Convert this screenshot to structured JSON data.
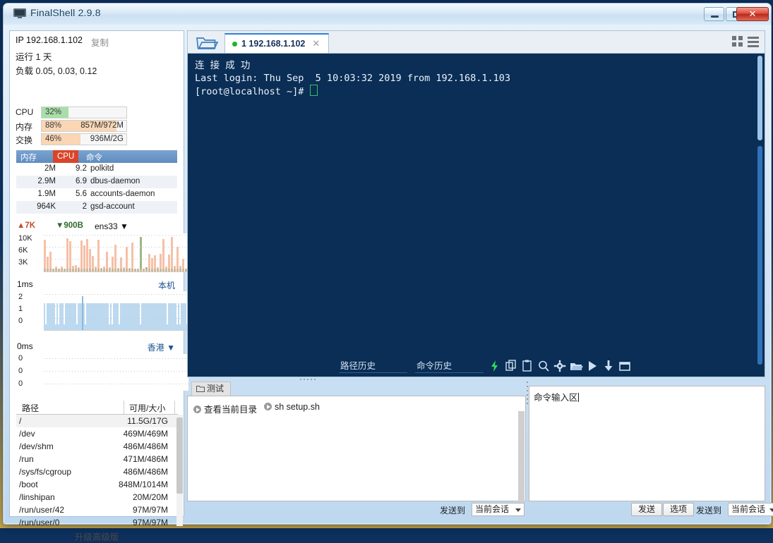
{
  "window": {
    "title": "FinalShell 2.9.8",
    "app_icon": "monitor-icon",
    "minimize": "–",
    "maximize": "□",
    "close": "✕"
  },
  "sidebar": {
    "ip_label": "IP 192.168.1.102",
    "copy_label": "复制",
    "uptime": "运行 1 天",
    "load": "负载 0.05, 0.03, 0.12",
    "meters": [
      {
        "name": "CPU",
        "percent": "32%",
        "value": "",
        "fill": 32,
        "color": "#a8dfa8"
      },
      {
        "name": "内存",
        "percent": "88%",
        "value": "857M/972M",
        "fill": 88,
        "color": "#fad6b4"
      },
      {
        "name": "交换",
        "percent": "46%",
        "value": "936M/2G",
        "fill": 46,
        "color": "#fad6b4"
      }
    ],
    "process_table": {
      "headers": [
        "内存",
        "CPU",
        "命令"
      ],
      "rows": [
        {
          "mem": "2M",
          "cpu": "9.2",
          "cmd": "polkitd"
        },
        {
          "mem": "2.9M",
          "cpu": "6.9",
          "cmd": "dbus-daemon"
        },
        {
          "mem": "1.9M",
          "cpu": "5.6",
          "cmd": "accounts-daemon"
        },
        {
          "mem": "964K",
          "cpu": "2",
          "cmd": "gsd-account"
        }
      ]
    },
    "network": {
      "upload": "7K",
      "download": "900B",
      "interface": "ens33",
      "y_ticks": [
        "10K",
        "6K",
        "3K"
      ]
    },
    "ping_local": {
      "unit": "1ms",
      "location": "本机",
      "y_ticks": [
        "2",
        "1",
        "0"
      ]
    },
    "ping_remote": {
      "unit": "0ms",
      "location": "香港",
      "y_ticks": [
        "0",
        "0",
        "0"
      ]
    },
    "disk_table": {
      "headers": [
        "路径",
        "可用/大小"
      ],
      "rows": [
        {
          "path": "/",
          "size": "11.5G/17G"
        },
        {
          "path": "/dev",
          "size": "469M/469M"
        },
        {
          "path": "/dev/shm",
          "size": "486M/486M"
        },
        {
          "path": "/run",
          "size": "471M/486M"
        },
        {
          "path": "/sys/fs/cgroup",
          "size": "486M/486M"
        },
        {
          "path": "/boot",
          "size": "848M/1014M"
        },
        {
          "path": "/linshipan",
          "size": "20M/20M"
        },
        {
          "path": "/run/user/42",
          "size": "97M/97M"
        },
        {
          "path": "/run/user/0",
          "size": "97M/97M"
        }
      ]
    },
    "upgrade_label": "升级高级版"
  },
  "main": {
    "folder_icon": "open-folder-icon",
    "tab": {
      "label": "1 192.168.1.102",
      "status": "connected",
      "close": "✕"
    },
    "view_grid_icon": "grid-view-icon",
    "view_list_icon": "list-view-icon",
    "terminal": {
      "lines": [
        "连 接 成 功",
        "Last login: Thu Sep  5 10:03:32 2019 from 192.168.1.103",
        "[root@localhost ~]# "
      ]
    },
    "toolbar": {
      "path_history": "路径历史",
      "command_history": "命令历史",
      "icons": [
        "lightning-icon",
        "copy-icon",
        "paste-icon",
        "search-icon",
        "gear-icon",
        "folder-open-icon",
        "play-icon",
        "download-icon",
        "window-icon"
      ]
    }
  },
  "bottom_left": {
    "tab_label": "测试",
    "tab_icon": "folder-icon",
    "commands": [
      {
        "label": "查看当前目录"
      },
      {
        "label": "sh setup.sh"
      }
    ],
    "send_to_label": "发送到",
    "send_target": "当前会话"
  },
  "bottom_right": {
    "input_value": "命令输入区",
    "send_button": "发送",
    "options_button": "选项",
    "send_to_label": "发送到",
    "send_target": "当前会话"
  },
  "colors": {
    "terminal_bg": "#0a2e55",
    "accent_blue": "#2f7ed8",
    "cpu_green": "#a8dfa8",
    "mem_orange": "#fad6b4",
    "cpu_header_red": "#d9452a",
    "status_green": "#23b523"
  }
}
